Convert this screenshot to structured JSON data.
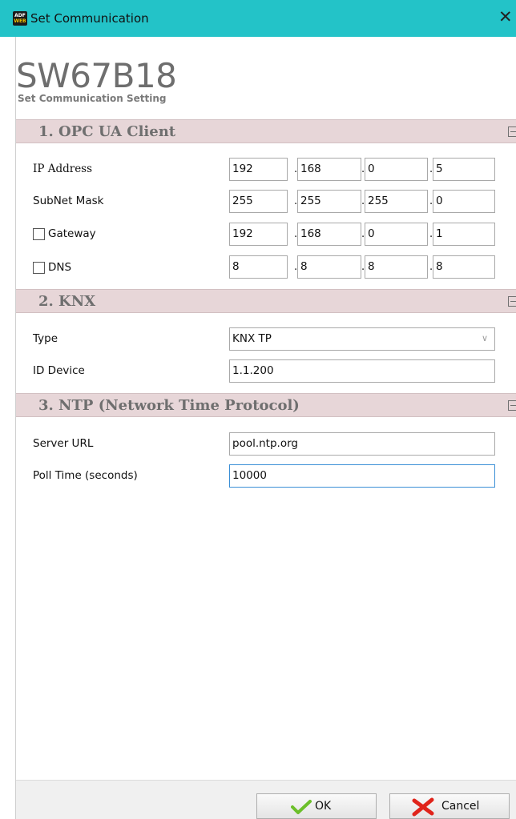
{
  "window": {
    "title": "Set Communication",
    "app_icon_text_top": "ADF",
    "app_icon_text_bottom": "WEB",
    "close_glyph": "✕"
  },
  "header": {
    "title": "SW67B18",
    "subtitle": "Set Communication Setting"
  },
  "sections": {
    "opc": {
      "title": "1. OPC UA Client",
      "ip_label": "IP Address",
      "ip": [
        "192",
        "168",
        "0",
        "5"
      ],
      "subnet_label": "SubNet Mask",
      "subnet": [
        "255",
        "255",
        "255",
        "0"
      ],
      "gateway_label": "Gateway",
      "gateway_checked": false,
      "gateway": [
        "192",
        "168",
        "0",
        "1"
      ],
      "dns_label": "DNS",
      "dns_checked": false,
      "dns": [
        "8",
        "8",
        "8",
        "8"
      ]
    },
    "knx": {
      "title": "2. KNX",
      "type_label": "Type",
      "type_value": "KNX TP",
      "id_label": "ID Device",
      "id_value": "1.1.200"
    },
    "ntp": {
      "title": "3. NTP (Network Time Protocol)",
      "server_label": "Server URL",
      "server_value": "pool.ntp.org",
      "poll_label": "Poll Time (seconds)",
      "poll_value": "10000"
    }
  },
  "footer": {
    "ok_label": "OK",
    "cancel_label": "Cancel"
  },
  "colors": {
    "titlebar": "#23c3c8",
    "section_bar": "#e7d6d8",
    "ok_check": "#6cbf2a",
    "cancel_x": "#e0241b"
  },
  "icons": {
    "collapse": "collapse-icon",
    "chevron": "chevron-down-icon",
    "ok": "check-icon",
    "cancel": "cross-icon"
  }
}
